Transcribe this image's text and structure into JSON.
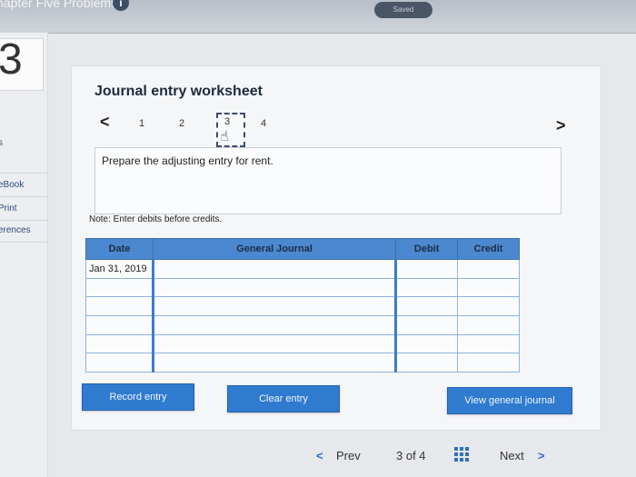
{
  "header": {
    "chapter_title": "hapter Five Problems",
    "info_icon": "i",
    "saved_label": "Saved"
  },
  "sidebar": {
    "question_number": "3",
    "items": [
      {
        "label": "s"
      },
      {
        "label": "eBook"
      },
      {
        "label": "Print"
      },
      {
        "label": "erences"
      }
    ]
  },
  "worksheet": {
    "title": "Journal entry worksheet",
    "prev_arrow": "<",
    "next_arrow": ">",
    "steps": [
      "1",
      "2",
      "3",
      "4"
    ],
    "current_step": "3",
    "prompt": "Prepare the adjusting entry for rent.",
    "note": "Note: Enter debits before credits."
  },
  "journal": {
    "columns": [
      "Date",
      "General Journal",
      "Debit",
      "Credit"
    ],
    "rows": [
      {
        "date": "Jan 31, 2019",
        "account": "",
        "debit": "",
        "credit": ""
      },
      {
        "date": "",
        "account": "",
        "debit": "",
        "credit": ""
      },
      {
        "date": "",
        "account": "",
        "debit": "",
        "credit": ""
      },
      {
        "date": "",
        "account": "",
        "debit": "",
        "credit": ""
      },
      {
        "date": "",
        "account": "",
        "debit": "",
        "credit": ""
      },
      {
        "date": "",
        "account": "",
        "debit": "",
        "credit": ""
      }
    ]
  },
  "buttons": {
    "record": "Record entry",
    "clear": "Clear entry",
    "view": "View general journal"
  },
  "pager": {
    "prev_label": "Prev",
    "position": "3 of 4",
    "next_label": "Next",
    "prev_icon": "<",
    "next_icon": ">"
  },
  "colors": {
    "accent": "#2f7bd0",
    "table_header": "#4c88cf"
  }
}
